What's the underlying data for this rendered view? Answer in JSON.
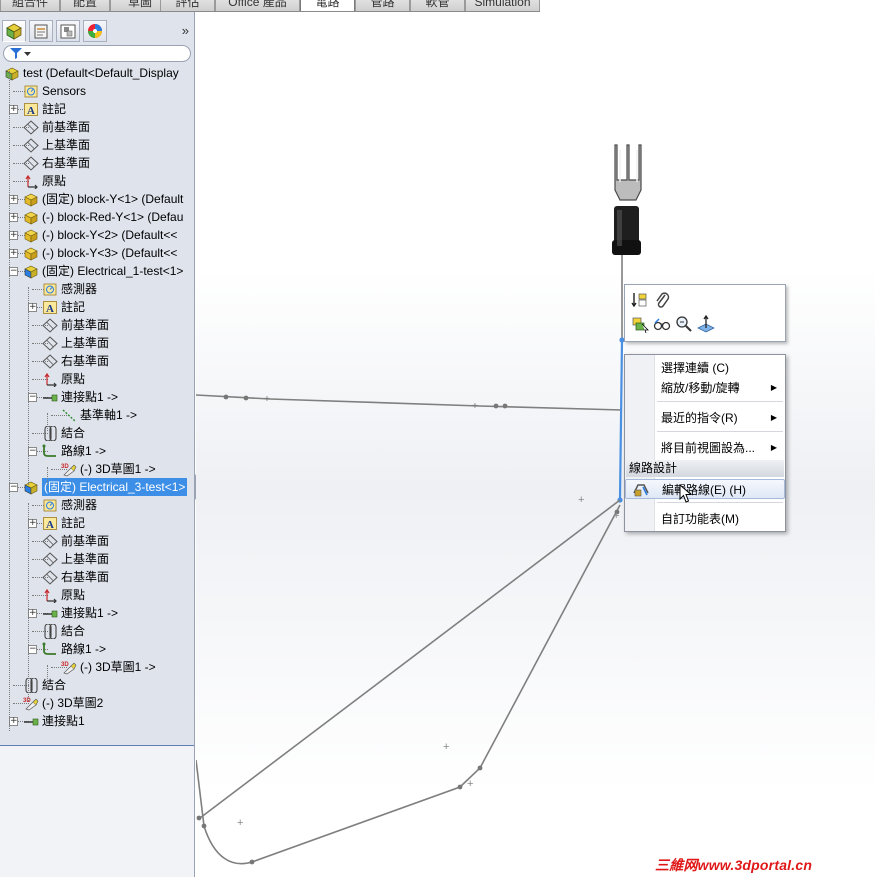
{
  "tabs": [
    "組合件",
    "配置",
    "草圖",
    "評估",
    "Office 產品",
    "電路",
    "管路",
    "軟管",
    "Simulation"
  ],
  "active_tab": "電路",
  "panel": {
    "chevrons": "»",
    "tree": [
      {
        "label": "test  (Default<Default_Display",
        "icon": "assembly-icon",
        "level": 0,
        "exp": ""
      },
      {
        "label": "Sensors",
        "icon": "sensor-icon",
        "level": 1,
        "exp": ""
      },
      {
        "label": "註記",
        "icon": "annotation-icon",
        "level": 1,
        "exp": "+"
      },
      {
        "label": "前基準面",
        "icon": "plane-icon",
        "level": 1,
        "exp": ""
      },
      {
        "label": "上基準面",
        "icon": "plane-icon",
        "level": 1,
        "exp": ""
      },
      {
        "label": "右基準面",
        "icon": "plane-icon",
        "level": 1,
        "exp": ""
      },
      {
        "label": "原點",
        "icon": "origin-icon",
        "level": 1,
        "exp": ""
      },
      {
        "label": "(固定) block-Y<1> (Default",
        "icon": "part-icon",
        "level": 1,
        "exp": "+"
      },
      {
        "label": "(-) block-Red-Y<1> (Defau",
        "icon": "part-icon",
        "level": 1,
        "exp": "+"
      },
      {
        "label": "(-) block-Y<2> (Default<<",
        "icon": "part-icon",
        "level": 1,
        "exp": "+"
      },
      {
        "label": "(-) block-Y<3> (Default<<",
        "icon": "part-icon",
        "level": 1,
        "exp": "+"
      },
      {
        "label": "(固定) Electrical_1-test<1>",
        "icon": "subassembly-icon",
        "level": 1,
        "exp": "-"
      },
      {
        "label": "感測器",
        "icon": "sensor-icon",
        "level": 2,
        "exp": ""
      },
      {
        "label": "註記",
        "icon": "annotation-icon",
        "level": 2,
        "exp": "+"
      },
      {
        "label": "前基準面",
        "icon": "plane-icon",
        "level": 2,
        "exp": ""
      },
      {
        "label": "上基準面",
        "icon": "plane-icon",
        "level": 2,
        "exp": ""
      },
      {
        "label": "右基準面",
        "icon": "plane-icon",
        "level": 2,
        "exp": ""
      },
      {
        "label": "原點",
        "icon": "origin-icon",
        "level": 2,
        "exp": ""
      },
      {
        "label": "連接點1 ->",
        "icon": "connection-point-icon",
        "level": 2,
        "exp": "-"
      },
      {
        "label": "基準軸1 ->",
        "icon": "axis-icon",
        "level": 3,
        "exp": ""
      },
      {
        "label": "結合",
        "icon": "mate-icon",
        "level": 2,
        "exp": ""
      },
      {
        "label": "路線1 ->",
        "icon": "route-icon",
        "level": 2,
        "exp": "-"
      },
      {
        "label": "(-) 3D草圖1 ->",
        "icon": "sketch3d-icon",
        "level": 3,
        "exp": ""
      },
      {
        "label": "(固定) Electrical_3-test<1>",
        "icon": "subassembly-icon",
        "level": 1,
        "exp": "-",
        "selected": true
      },
      {
        "label": "感測器",
        "icon": "sensor-icon",
        "level": 2,
        "exp": ""
      },
      {
        "label": "註記",
        "icon": "annotation-icon",
        "level": 2,
        "exp": "+"
      },
      {
        "label": "前基準面",
        "icon": "plane-icon",
        "level": 2,
        "exp": ""
      },
      {
        "label": "上基準面",
        "icon": "plane-icon",
        "level": 2,
        "exp": ""
      },
      {
        "label": "右基準面",
        "icon": "plane-icon",
        "level": 2,
        "exp": ""
      },
      {
        "label": "原點",
        "icon": "origin-icon",
        "level": 2,
        "exp": ""
      },
      {
        "label": "連接點1 ->",
        "icon": "connection-point-icon",
        "level": 2,
        "exp": "+"
      },
      {
        "label": "結合",
        "icon": "mate-icon",
        "level": 2,
        "exp": ""
      },
      {
        "label": "路線1 ->",
        "icon": "route-icon",
        "level": 2,
        "exp": "-"
      },
      {
        "label": "(-) 3D草圖1 ->",
        "icon": "sketch3d-icon",
        "level": 3,
        "exp": ""
      },
      {
        "label": "結合",
        "icon": "mate-icon",
        "level": 1,
        "exp": ""
      },
      {
        "label": "(-) 3D草圖2",
        "icon": "sketch3d-icon",
        "level": 1,
        "exp": ""
      },
      {
        "label": "連接點1",
        "icon": "connection-point-icon",
        "level": 1,
        "exp": "+"
      }
    ]
  },
  "context_menu": {
    "items": [
      {
        "label": "選擇連續 (C)",
        "arrow": false
      },
      {
        "label": "縮放/移動/旋轉",
        "arrow": true
      },
      {
        "label": "最近的指令(R)",
        "arrow": true
      },
      {
        "label": "將目前視圖設為...",
        "arrow": true
      }
    ],
    "section_header": "線路設計",
    "edit_route": "編輯路線(E) (H)",
    "customize": "自訂功能表(M)"
  },
  "context_toolbar": {
    "icons": [
      "mate-reference-icon",
      "paperclip-icon",
      "select-component-icon",
      "view-orientation-icon",
      "zoom-icon",
      "normal-to-icon"
    ]
  },
  "watermark": "三維网www.3dportal.cn",
  "colors": {
    "selection": "#3d8ee6",
    "panel_bg": "#dfe3ec",
    "route_highlight": "#4a90e2",
    "route_line": "#808080",
    "watermark": "#e01818"
  }
}
